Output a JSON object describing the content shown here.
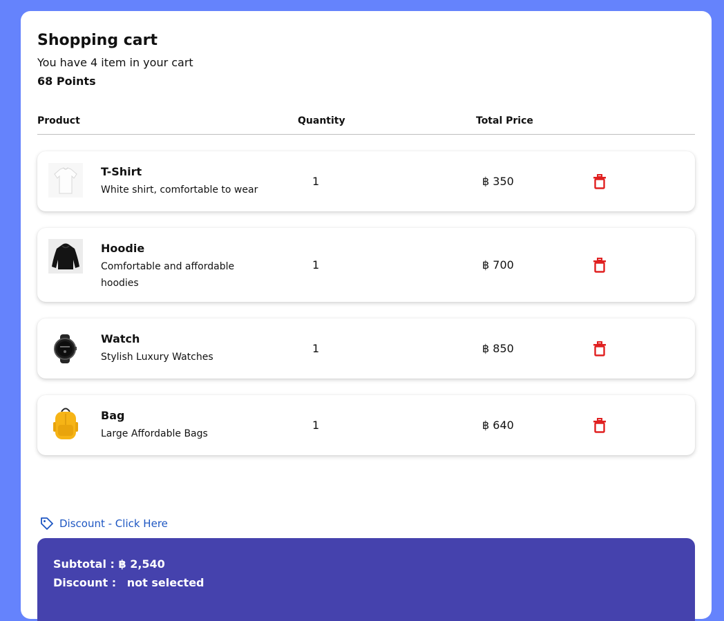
{
  "cart": {
    "title": "Shopping cart",
    "subtitle": "You have 4 item in your cart",
    "points": "68 Points"
  },
  "table": {
    "headers": {
      "product": "Product",
      "quantity": "Quantity",
      "total_price": "Total Price"
    }
  },
  "items": [
    {
      "name": "T-Shirt",
      "description": "White shirt, comfortable to wear",
      "quantity": "1",
      "price": "฿ 350",
      "image_icon": "tshirt-icon"
    },
    {
      "name": "Hoodie",
      "description": "Comfortable and affordable hoodies",
      "quantity": "1",
      "price": "฿ 700",
      "image_icon": "hoodie-icon"
    },
    {
      "name": "Watch",
      "description": "Stylish Luxury Watches",
      "quantity": "1",
      "price": "฿ 850",
      "image_icon": "watch-icon"
    },
    {
      "name": "Bag",
      "description": "Large Affordable Bags",
      "quantity": "1",
      "price": "฿ 640",
      "image_icon": "backpack-icon"
    }
  ],
  "discount_link": {
    "label": "Discount - Click Here",
    "icon": "tag-icon"
  },
  "summary": {
    "subtotal_label": "Subtotal :",
    "subtotal_value": "฿ 2,540",
    "discount_label": "Discount :",
    "discount_value": "not selected"
  },
  "colors": {
    "page_background": "#6583fc",
    "summary_background": "#4542ad",
    "delete_icon": "#e02020",
    "link": "#1d56c2"
  }
}
